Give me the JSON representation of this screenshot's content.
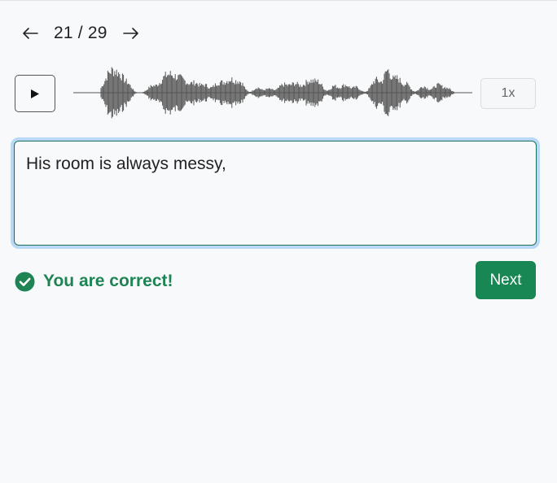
{
  "pager": {
    "current": "21",
    "separator": "/",
    "total": "29",
    "prev_icon": "arrow-left-icon",
    "next_icon": "arrow-right-icon"
  },
  "player": {
    "play_icon": "play-icon",
    "speed_label": "1x"
  },
  "answer": {
    "value": "His room is always messy,"
  },
  "result": {
    "icon": "check-circle-icon",
    "message": "You are correct!",
    "color": "#1e8454"
  },
  "actions": {
    "next_label": "Next",
    "next_color": "#198754"
  },
  "colors": {
    "focus_ring": "#b9d8f5",
    "input_border": "#1b6e57",
    "waveform": "#555555",
    "background": "#f8f9fb"
  }
}
